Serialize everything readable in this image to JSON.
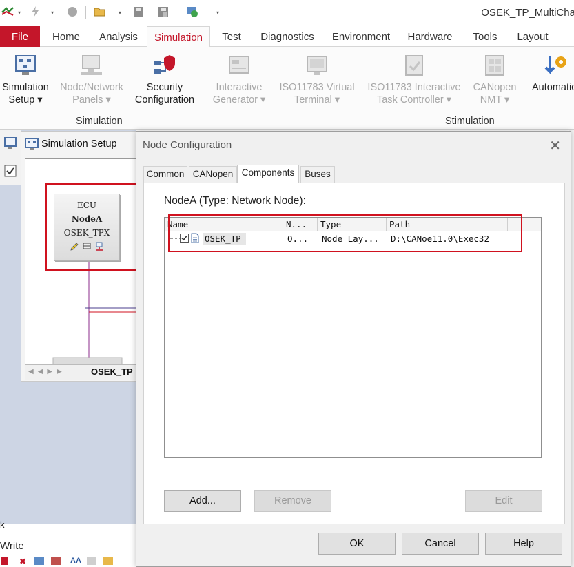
{
  "window": {
    "title": "OSEK_TP_MultiCha"
  },
  "ribbon_tabs": [
    {
      "label": "File"
    },
    {
      "label": "Home"
    },
    {
      "label": "Analysis"
    },
    {
      "label": "Simulation"
    },
    {
      "label": "Test"
    },
    {
      "label": "Diagnostics"
    },
    {
      "label": "Environment"
    },
    {
      "label": "Hardware"
    },
    {
      "label": "Tools"
    },
    {
      "label": "Layout"
    }
  ],
  "ribbon": {
    "simulation_setup": {
      "line1": "Simulation",
      "line2": "Setup ▾"
    },
    "node_network_panels": {
      "line1": "Node/Network",
      "line2": "Panels ▾"
    },
    "security_configuration": {
      "line1": "Security",
      "line2": "Configuration"
    },
    "interactive_generator": {
      "line1": "Interactive",
      "line2": "Generator ▾"
    },
    "iso11783_virtual_terminal": {
      "line1": "ISO11783 Virtual",
      "line2": "Terminal ▾"
    },
    "iso11783_task_controller": {
      "line1": "ISO11783 Interactive",
      "line2": "Task Controller ▾"
    },
    "canopen_nmt": {
      "line1": "CANopen",
      "line2": "NMT ▾"
    },
    "automation": {
      "line1": "Automatio"
    },
    "group_simulation": "Simulation",
    "group_stimulation": "Stimulation"
  },
  "left_panel": {
    "title": "Simulation Setup",
    "ecu": {
      "type": "ECU",
      "name": "NodeA",
      "module": "OSEK_TPX"
    },
    "sheet_tab": "OSEK_TP",
    "bottom_label": "Write",
    "collapse_glyph": "k"
  },
  "dialog": {
    "title": "Node Configuration",
    "close_glyph": "✕",
    "tabs": [
      {
        "label": "Common"
      },
      {
        "label": "CANopen"
      },
      {
        "label": "Components"
      },
      {
        "label": "Buses"
      }
    ],
    "heading": "NodeA (Type: Network Node):",
    "columns": [
      "Name",
      "N...",
      "Type",
      "Path"
    ],
    "rows": [
      {
        "name": "OSEK_TP",
        "n": "O...",
        "type": "Node Lay...",
        "path": "D:\\CANoe11.0\\Exec32",
        "checked": true
      }
    ],
    "buttons": {
      "add": "Add...",
      "remove": "Remove",
      "edit": "Edit",
      "ok": "OK",
      "cancel": "Cancel",
      "help": "Help"
    }
  },
  "colors": {
    "file_tab": "#c4162a",
    "highlight": "#d0121f",
    "active_tab_text": "#c4162a"
  }
}
